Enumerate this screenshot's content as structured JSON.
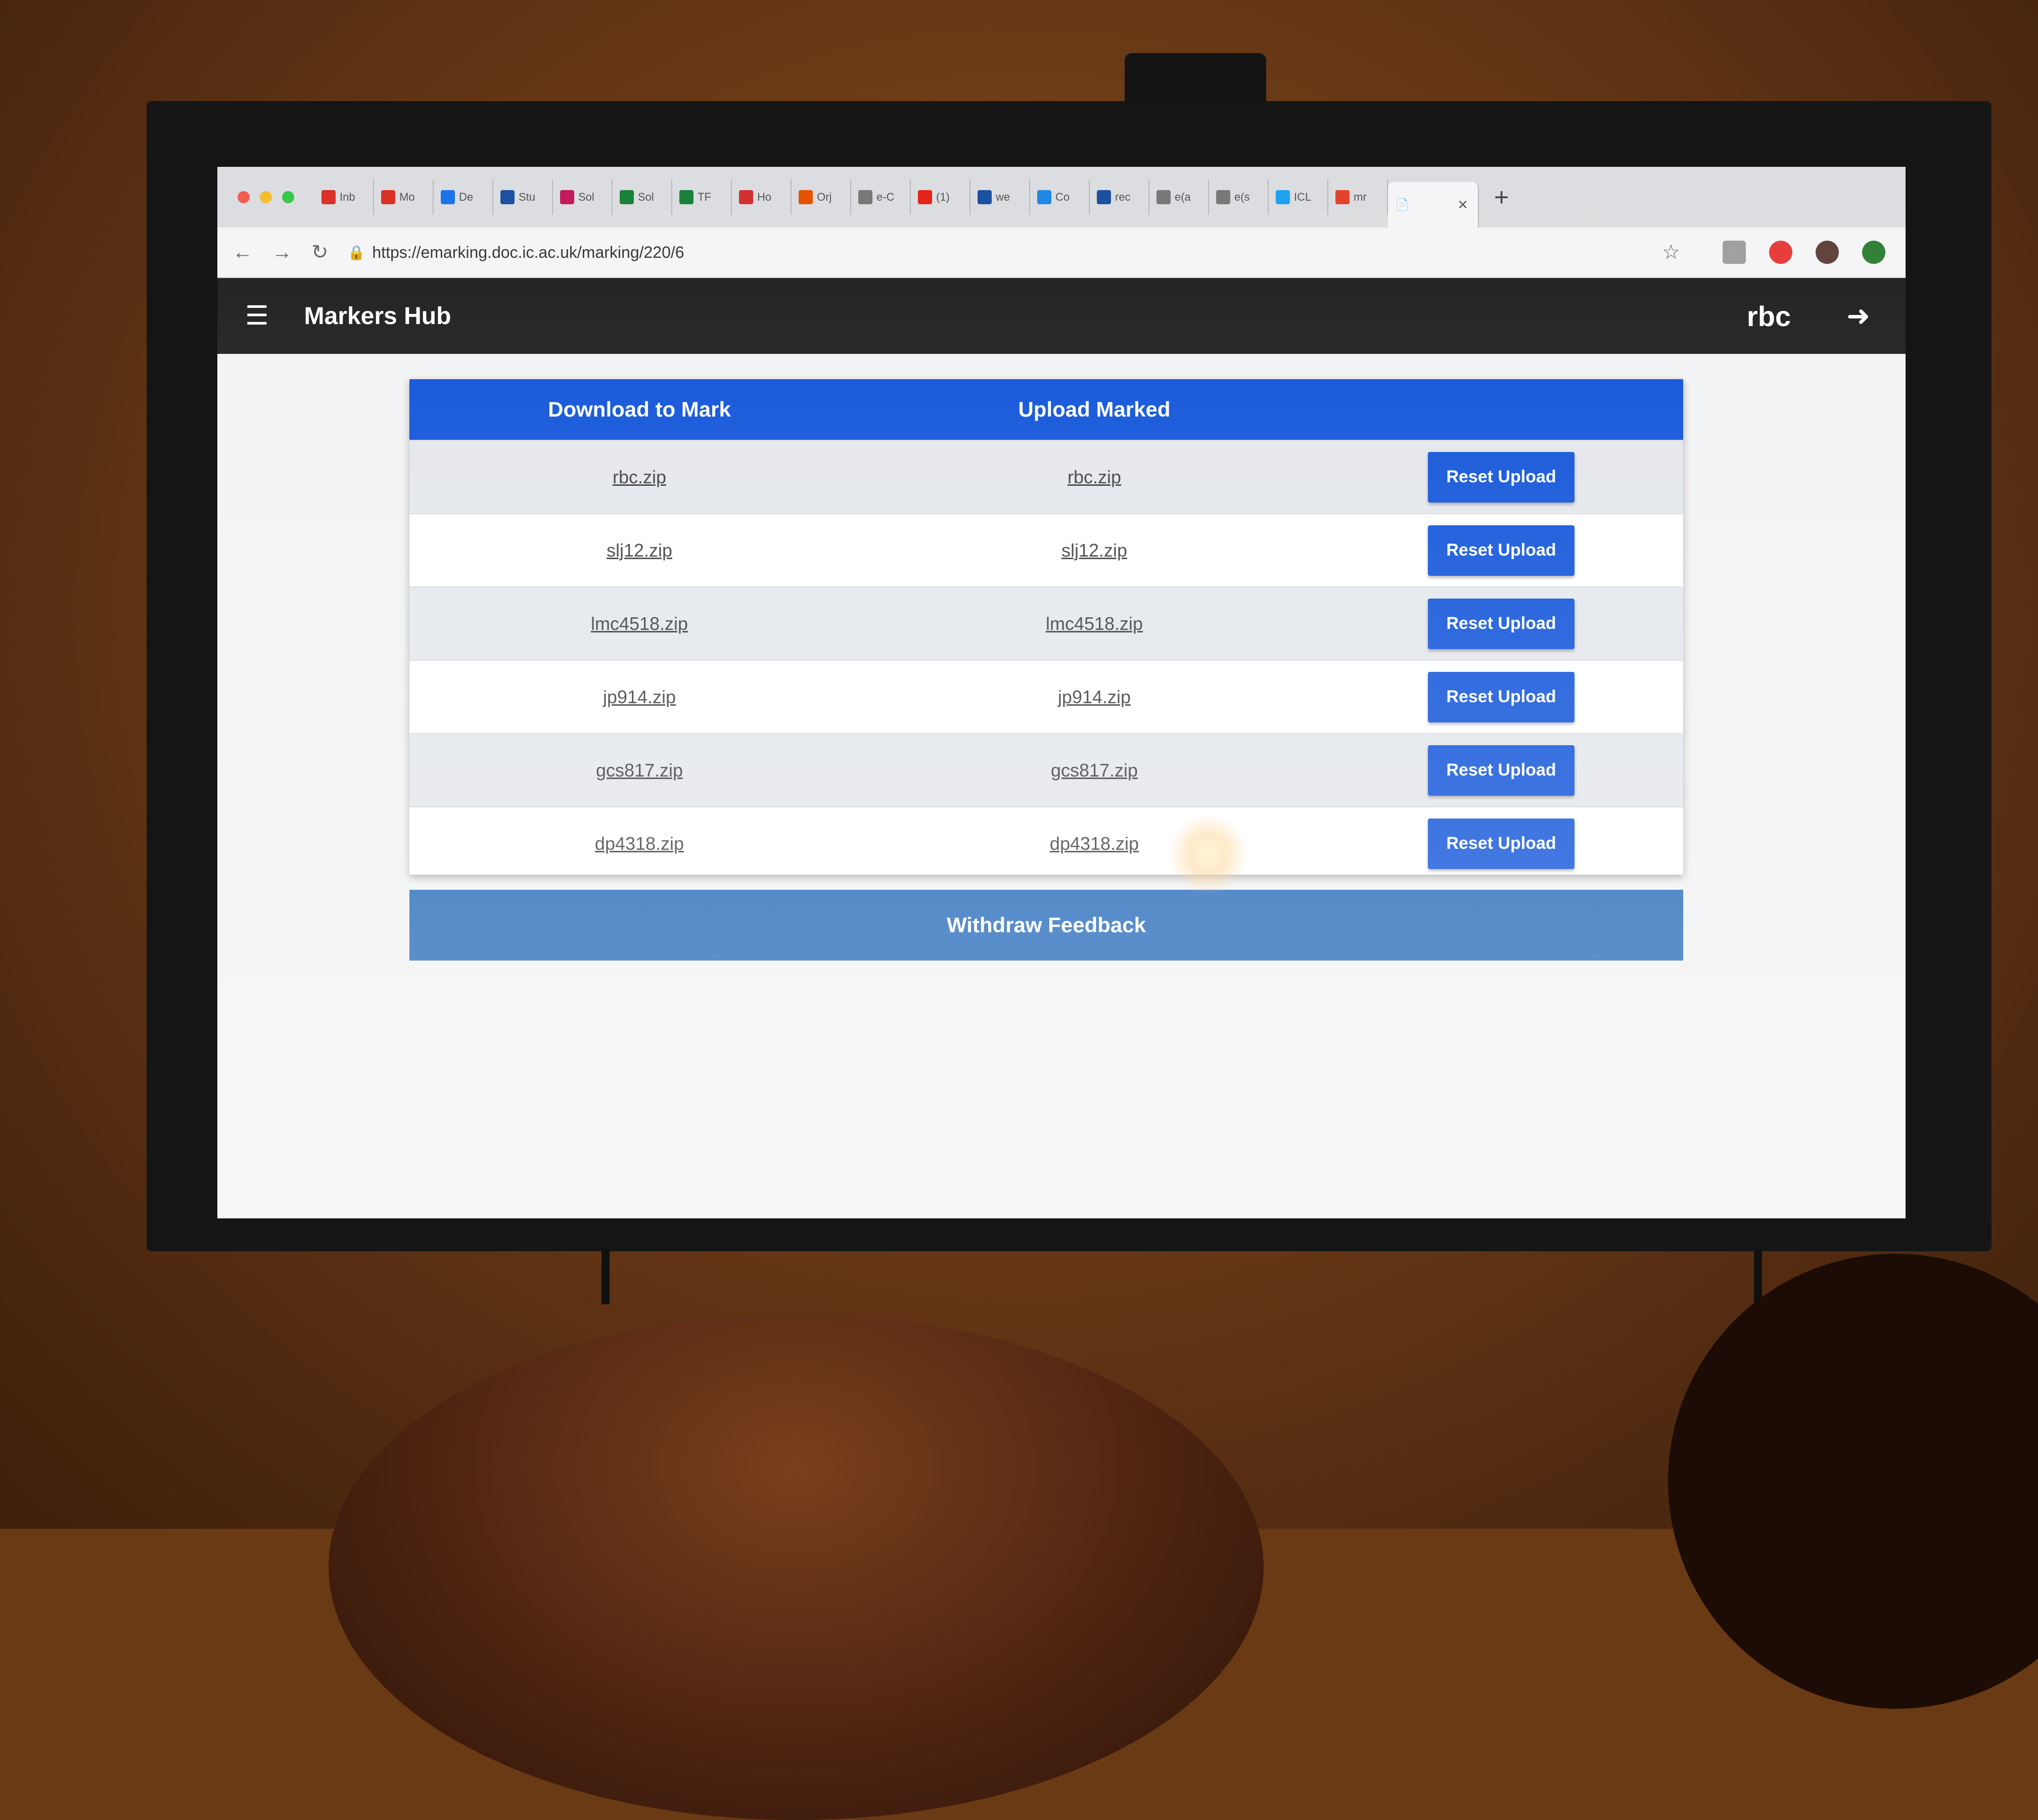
{
  "browser": {
    "tabs": [
      {
        "label": "Inb",
        "icon": "gmail-icon",
        "color": "#d93025"
      },
      {
        "label": "Mo",
        "icon": "gmail-icon",
        "color": "#d93025"
      },
      {
        "label": "De",
        "icon": "calendar-icon",
        "color": "#1a73e8"
      },
      {
        "label": "Stu",
        "icon": "bookmark-icon",
        "color": "#1a4fa0"
      },
      {
        "label": "Sol",
        "icon": "circle-icon",
        "color": "#c2185b"
      },
      {
        "label": "Sol",
        "icon": "sheet-icon",
        "color": "#188038"
      },
      {
        "label": "TF",
        "icon": "sheet-icon",
        "color": "#188038"
      },
      {
        "label": "Ho",
        "icon": "square-icon",
        "color": "#d32f2f"
      },
      {
        "label": "Orj",
        "icon": "shield-icon",
        "color": "#e65100"
      },
      {
        "label": "e-C",
        "icon": "page-icon",
        "color": "#777777"
      },
      {
        "label": "(1)",
        "icon": "youtube-icon",
        "color": "#e62117"
      },
      {
        "label": "we",
        "icon": "drop-icon",
        "color": "#1a4fa0"
      },
      {
        "label": "Co",
        "icon": "globe-icon",
        "color": "#1e88e5"
      },
      {
        "label": "rec",
        "icon": "drop-icon",
        "color": "#1a4fa0"
      },
      {
        "label": "e(a",
        "icon": "page-icon",
        "color": "#777777"
      },
      {
        "label": "e(s",
        "icon": "page-icon",
        "color": "#777777"
      },
      {
        "label": "ICL",
        "icon": "twitter-icon",
        "color": "#1da1f2"
      },
      {
        "label": "mr",
        "icon": "gitlab-icon",
        "color": "#e24329"
      }
    ],
    "url": "https://emarking.doc.ic.ac.uk/marking/220/6"
  },
  "app": {
    "title": "Markers Hub",
    "user": "rbc"
  },
  "table": {
    "headers": [
      "Download to Mark",
      "Upload Marked"
    ],
    "rows": [
      {
        "download": "rbc.zip",
        "upload": "rbc.zip",
        "action": "Reset Upload"
      },
      {
        "download": "slj12.zip",
        "upload": "slj12.zip",
        "action": "Reset Upload"
      },
      {
        "download": "lmc4518.zip",
        "upload": "lmc4518.zip",
        "action": "Reset Upload"
      },
      {
        "download": "jp914.zip",
        "upload": "jp914.zip",
        "action": "Reset Upload"
      },
      {
        "download": "gcs817.zip",
        "upload": "gcs817.zip",
        "action": "Reset Upload"
      },
      {
        "download": "dp4318.zip",
        "upload": "dp4318.zip",
        "action": "Reset Upload"
      }
    ]
  },
  "withdraw_label": "Withdraw Feedback",
  "colors": {
    "accent": "#0a4fd8",
    "withdraw": "#2067b8",
    "appbar": "#1c1c1c"
  }
}
